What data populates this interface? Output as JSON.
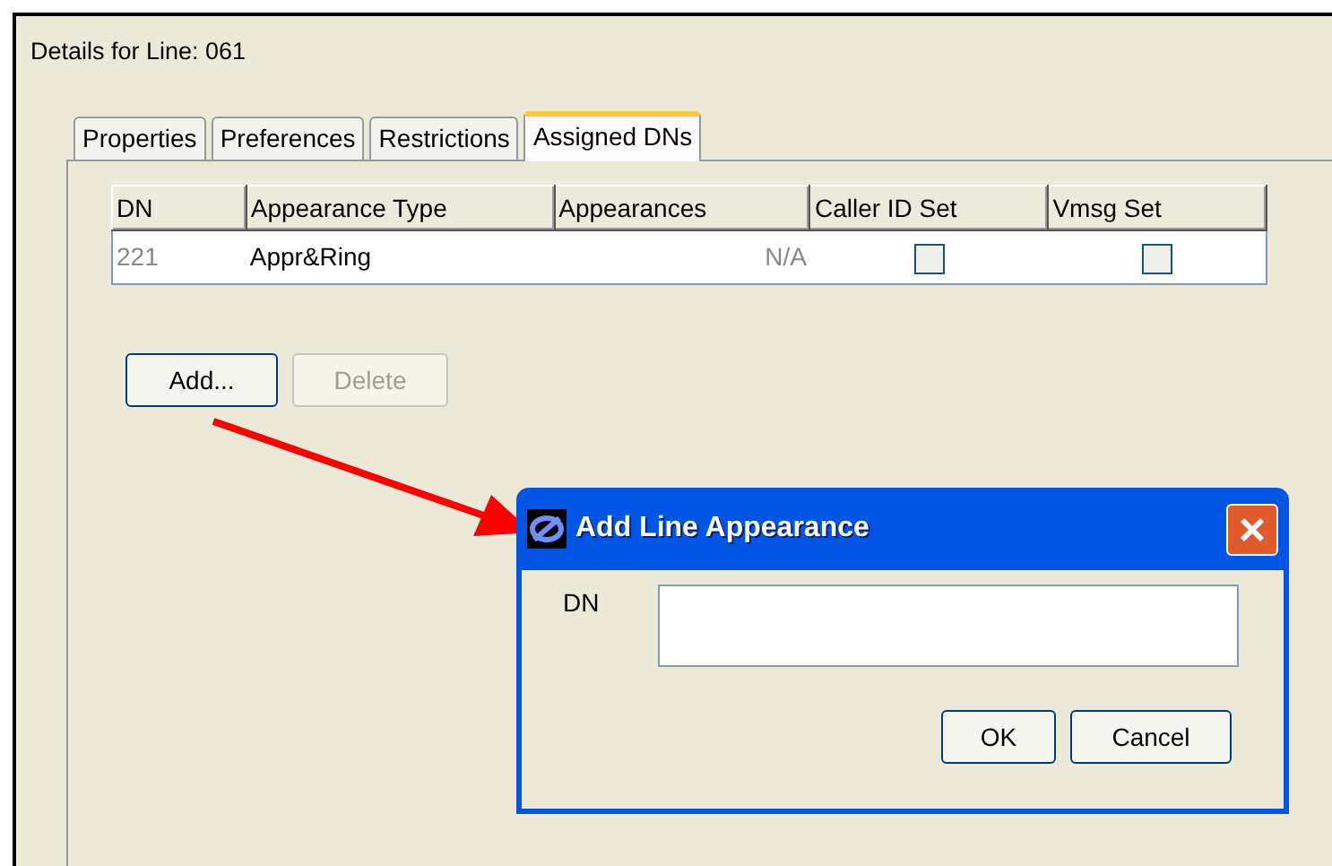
{
  "header": {
    "title": "Details for Line: 061"
  },
  "tabs": [
    {
      "label": "Properties",
      "selected": false
    },
    {
      "label": "Preferences",
      "selected": false
    },
    {
      "label": "Restrictions",
      "selected": false
    },
    {
      "label": "Assigned DNs",
      "selected": true
    }
  ],
  "table": {
    "columns": [
      "DN",
      "Appearance Type",
      "Appearances",
      "Caller ID Set",
      "Vmsg Set"
    ],
    "rows": [
      {
        "dn": "221",
        "appearance_type": "Appr&Ring",
        "appearances": "N/A",
        "caller_id_set": false,
        "vmsg_set": false
      }
    ]
  },
  "buttons": [
    {
      "label": "Add...",
      "disabled": false
    },
    {
      "label": "Delete",
      "disabled": true
    }
  ],
  "dialog": {
    "title": "Add Line Appearance",
    "field_label": "DN",
    "buttons": [
      "OK",
      "Cancel"
    ]
  }
}
